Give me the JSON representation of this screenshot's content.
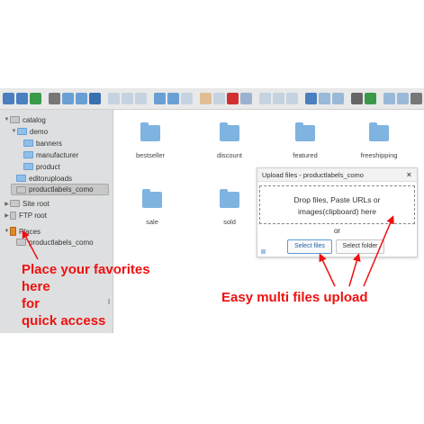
{
  "toolbar": {
    "icons": [
      "back-icon",
      "forward-icon",
      "up-icon",
      "home-icon",
      "view-icon",
      "view-icon",
      "save-icon",
      "open-icon",
      "save-icon",
      "copy-icon",
      "undo-icon",
      "redo-icon",
      "copy-icon",
      "cut-icon",
      "paste-icon",
      "delete-icon",
      "save-icon",
      "rename-icon",
      "duplicate-icon",
      "upload-icon",
      "grid-view-icon",
      "list-view-icon",
      "sort-icon",
      "preview-icon",
      "info-icon",
      "settings-icon",
      "settings-icon",
      "help-icon"
    ],
    "colors": [
      "#4a7fc0",
      "#4a7fc0",
      "#3a9a4a",
      "#777777",
      "#6a9fd6",
      "#6a9fd6",
      "#3a6fb0",
      "#9ab8d8",
      "#9ab8d8",
      "#9ab8d8",
      "#6a9fd6",
      "#6a9fd6",
      "#9ab8d8",
      "#d48a2a",
      "#9ab8d8",
      "#d03030",
      "#3a6fb0",
      "#9ab8d8",
      "#9ab8d8",
      "#9ab8d8",
      "#4a7fc0",
      "#9ab8d8",
      "#9ab8d8",
      "#666666",
      "#3a9a4a",
      "#9ab8d8",
      "#9ab8d8",
      "#777777"
    ]
  },
  "sidebar": {
    "items": [
      {
        "label": "catalog",
        "icon": "drive-icon"
      },
      {
        "label": "demo",
        "icon": "folder-icon"
      },
      {
        "label": "banners",
        "icon": "folder-icon"
      },
      {
        "label": "manufacturer",
        "icon": "folder-icon"
      },
      {
        "label": "product",
        "icon": "folder-icon"
      },
      {
        "label": "editoruploads",
        "icon": "folder-icon"
      },
      {
        "label": "productlabels_como",
        "icon": "folder-icon"
      },
      {
        "label": "Site root",
        "icon": "drive-icon"
      },
      {
        "label": "FTP root",
        "icon": "server-icon"
      },
      {
        "label": "Places",
        "icon": "places-icon"
      },
      {
        "label": "productlabels_como",
        "icon": "folder-icon"
      }
    ]
  },
  "files": [
    {
      "name": "bestseller"
    },
    {
      "name": "discount"
    },
    {
      "name": "featured"
    },
    {
      "name": "freeshipping"
    },
    {
      "name": "sale"
    },
    {
      "name": "sold"
    }
  ],
  "upload_dialog": {
    "title": "Upload files - productlabels_como",
    "close": "×",
    "drop_line1": "Drop files, Paste URLs or",
    "drop_line2": "images(clipboard) here",
    "or": "or",
    "select_files": "Select files",
    "select_folder": "Select folder"
  },
  "annotations": {
    "favorites": [
      "Place your favorites",
      "here",
      "for",
      "quick access"
    ],
    "multi_upload": "Easy multi files upload",
    "color": "#ee1111"
  },
  "colors": {
    "sidebar_bg": "#dedfe0",
    "folder": "#7fb3e0",
    "toolbar_bg": "#e9e9e9"
  }
}
